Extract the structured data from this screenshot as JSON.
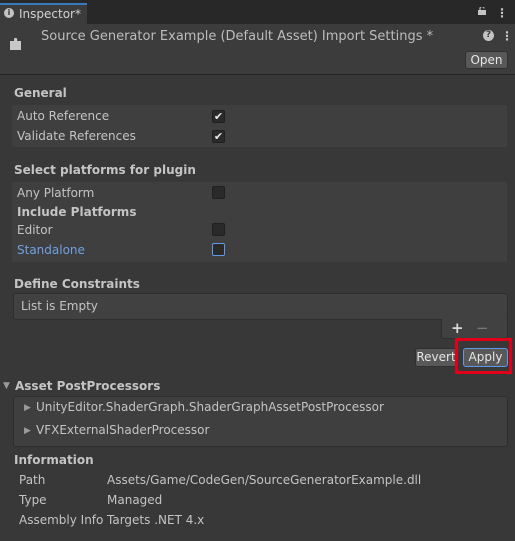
{
  "tab": {
    "info_glyph": "i",
    "title": "Inspector*"
  },
  "header": {
    "title": "Source Generator Example (Default Asset) Import Settings *",
    "open_label": "Open",
    "help_glyph": "?",
    "kebab_glyph": "⋮"
  },
  "general": {
    "title": "General",
    "rows": [
      {
        "label": "Auto Reference",
        "checked": true
      },
      {
        "label": "Validate References",
        "checked": true
      }
    ]
  },
  "platforms": {
    "title": "Select platforms for plugin",
    "any_platform": {
      "label": "Any Platform",
      "checked": false
    },
    "include_title": "Include Platforms",
    "editor": {
      "label": "Editor",
      "checked": false
    },
    "standalone": {
      "label": "Standalone",
      "checked": false
    }
  },
  "constraints": {
    "title": "Define Constraints",
    "empty_text": "List is Empty",
    "plus": "+",
    "minus": "−"
  },
  "actions": {
    "revert_label": "Revert",
    "apply_label": "Apply"
  },
  "postprocessors": {
    "title": "Asset PostProcessors",
    "items": [
      "UnityEditor.ShaderGraph.ShaderGraphAssetPostProcessor",
      "VFXExternalShaderProcessor"
    ]
  },
  "information": {
    "title": "Information",
    "rows": [
      {
        "key": "Path",
        "value": "Assets/Game/CodeGen/SourceGeneratorExample.dll"
      },
      {
        "key": "Type",
        "value": "Managed"
      },
      {
        "key": "Assembly Info",
        "value": "Targets .NET 4.x"
      }
    ]
  },
  "checkmark": "✔",
  "triangle_right": "▶",
  "triangle_down": "▼",
  "colors": {
    "accent": "#3a79bb",
    "highlight": "#e0001a",
    "link": "#6fa0e2"
  }
}
